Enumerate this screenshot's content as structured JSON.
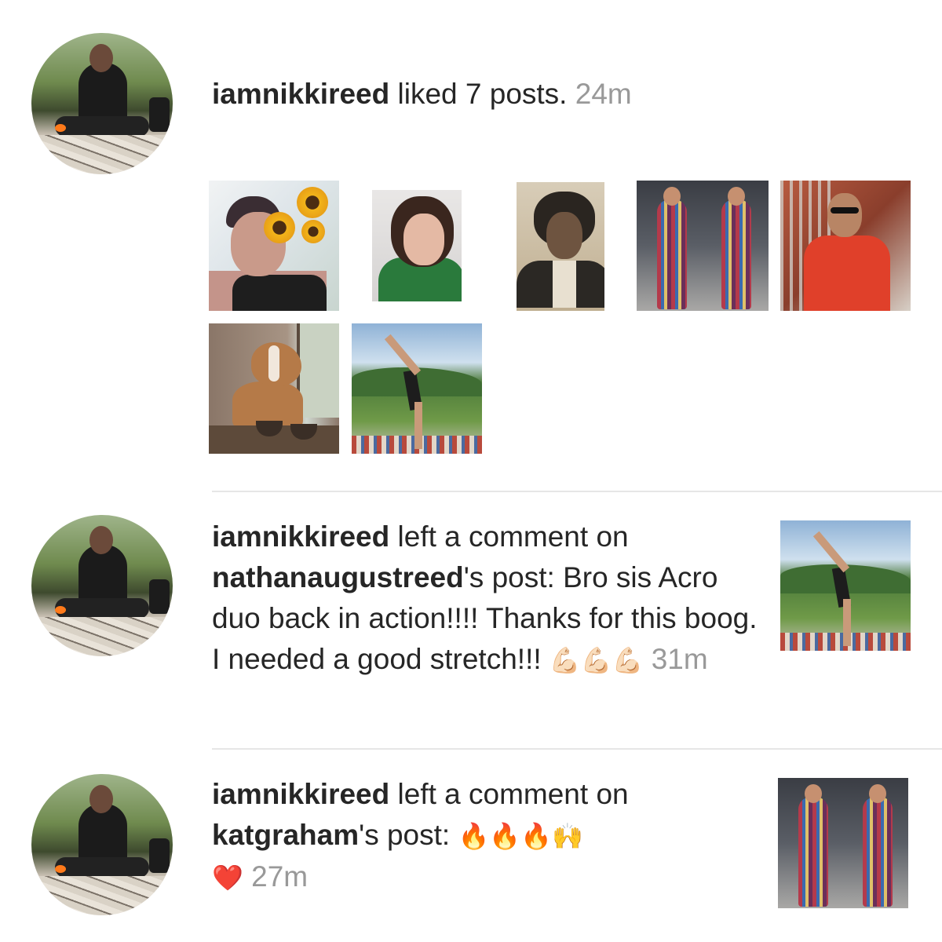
{
  "activity": [
    {
      "username": "iamnikkireed",
      "action": "liked 7 posts.",
      "time": "24m"
    },
    {
      "username": "iamnikkireed",
      "action_prefix": "left a comment on",
      "target_user": "nathanaugustreed",
      "possessive": "'s post:",
      "comment": "Bro sis Acro duo back in action!!!! Thanks for this boog. I needed a good stretch!!!",
      "emojis": "💪🏻💪🏻💪🏻",
      "time": "31m"
    },
    {
      "username": "iamnikkireed",
      "action_prefix": "left a comment on",
      "target_user": "katgraham",
      "possessive": "'s post:",
      "emojis": "🔥🔥🔥🙌",
      "heart": "❤️",
      "time": "27m"
    }
  ],
  "liked_thumbnails": [
    "sunflower-selfie",
    "green-top-portrait",
    "vintage-portrait",
    "striped-suit-duo",
    "red-jacket",
    "dog-at-window",
    "acro-yoga"
  ]
}
